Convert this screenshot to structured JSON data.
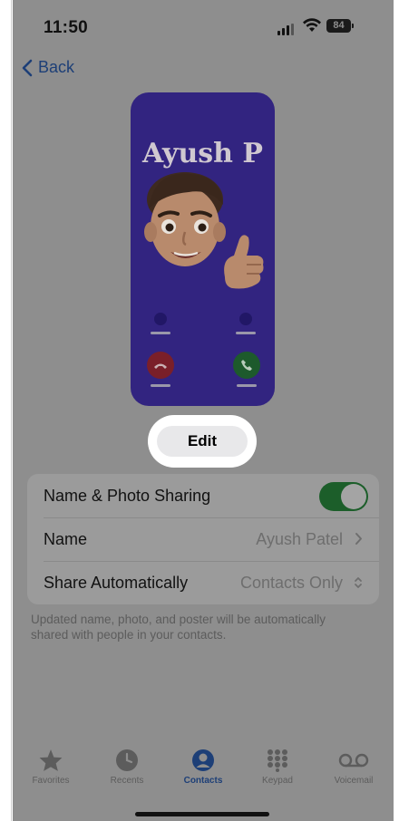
{
  "status_bar": {
    "time": "11:50",
    "battery": "84"
  },
  "nav": {
    "back_label": "Back"
  },
  "poster": {
    "name": "Ayush P"
  },
  "edit_button": {
    "label": "Edit"
  },
  "settings": {
    "name_photo_sharing": {
      "label": "Name & Photo Sharing",
      "enabled": true
    },
    "name": {
      "label": "Name",
      "value": "Ayush Patel"
    },
    "share_automatically": {
      "label": "Share Automatically",
      "value": "Contacts Only"
    },
    "footer": "Updated name, photo, and poster will be automatically shared with people in your contacts."
  },
  "tabbar": {
    "items": [
      {
        "label": "Favorites",
        "icon": "star-icon"
      },
      {
        "label": "Recents",
        "icon": "clock-icon"
      },
      {
        "label": "Contacts",
        "icon": "person-circle-icon",
        "active": true
      },
      {
        "label": "Keypad",
        "icon": "keypad-icon"
      },
      {
        "label": "Voicemail",
        "icon": "voicemail-icon"
      }
    ]
  },
  "colors": {
    "accent": "#1d3f77",
    "toggle_on": "#1c5e2a",
    "poster_bg": "#322480"
  }
}
